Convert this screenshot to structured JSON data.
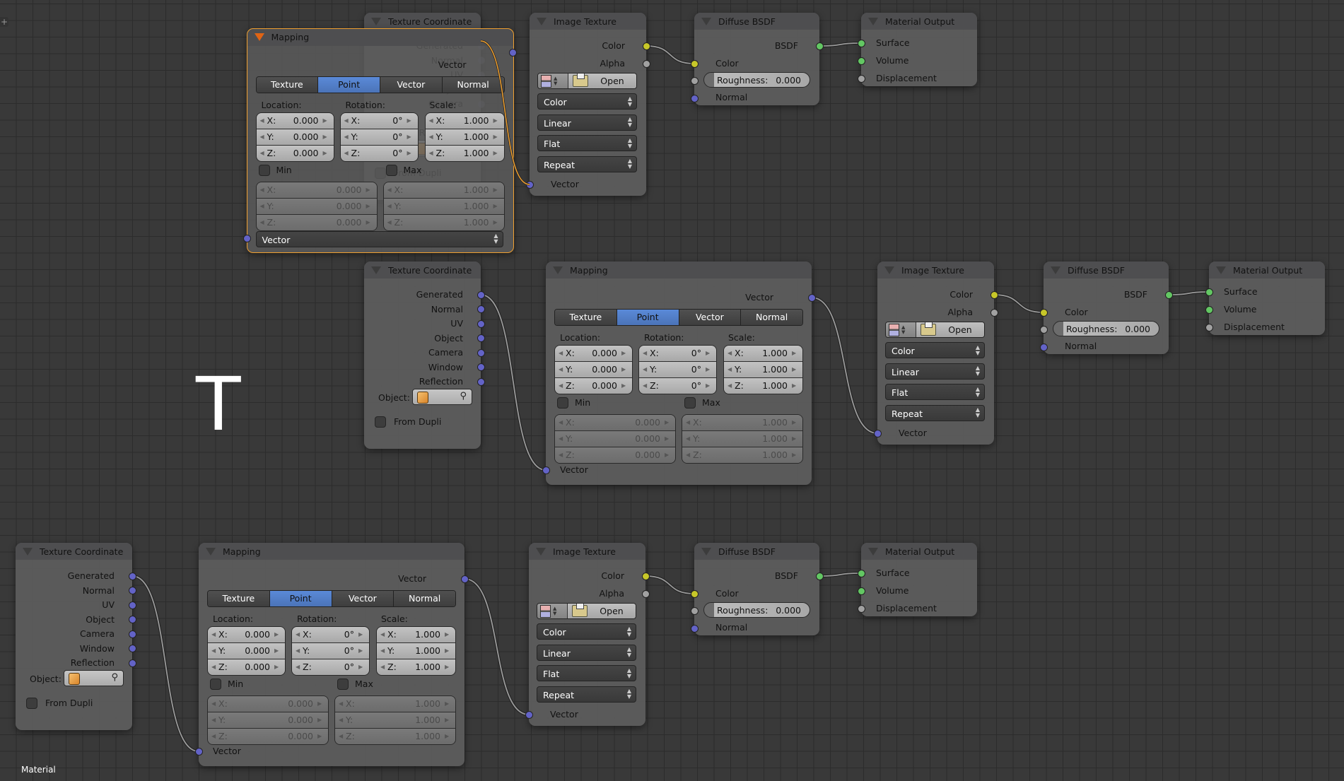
{
  "editor": {
    "footer_label": "Material",
    "add_button_icon": "plus-icon",
    "cursor_text": "T"
  },
  "colors": {
    "socket_vector": "#6363c7",
    "socket_color": "#c7c729",
    "socket_float": "#a1a1a1",
    "socket_shader": "#63c763",
    "selected_outline": "#f0a030",
    "active_tab": "#5a8ad8"
  },
  "common": {
    "tex_coord": {
      "title": "Texture Coordinate",
      "outputs": [
        "Generated",
        "Normal",
        "UV",
        "Object",
        "Camera",
        "Window",
        "Reflection"
      ],
      "object_label": "Object:",
      "from_dupli_label": "From Dupli"
    },
    "mapping": {
      "title": "Mapping",
      "output": "Vector",
      "tabs": [
        "Texture",
        "Point",
        "Vector",
        "Normal"
      ],
      "active_tab": "Point",
      "location_label": "Location:",
      "rotation_label": "Rotation:",
      "scale_label": "Scale:",
      "axes": [
        "X:",
        "Y:",
        "Z:"
      ],
      "location": [
        "0.000",
        "0.000",
        "0.000"
      ],
      "rotation": [
        "0°",
        "0°",
        "0°"
      ],
      "scale": [
        "1.000",
        "1.000",
        "1.000"
      ],
      "min_label": "Min",
      "max_label": "Max",
      "min": [
        "0.000",
        "0.000",
        "0.000"
      ],
      "max": [
        "1.000",
        "1.000",
        "1.000"
      ],
      "input": "Vector",
      "vector_type_dropdown": "Vector"
    },
    "image_texture": {
      "title": "Image Texture",
      "outputs": [
        "Color",
        "Alpha"
      ],
      "open_label": "Open",
      "dropdowns": [
        "Color",
        "Linear",
        "Flat",
        "Repeat"
      ],
      "input": "Vector"
    },
    "diffuse": {
      "title": "Diffuse BSDF",
      "output": "BSDF",
      "color_input": "Color",
      "roughness_label": "Roughness:",
      "roughness_value": "0.000",
      "normal_input": "Normal"
    },
    "material_output": {
      "title": "Material Output",
      "inputs": [
        "Surface",
        "Volume",
        "Displacement"
      ]
    }
  }
}
